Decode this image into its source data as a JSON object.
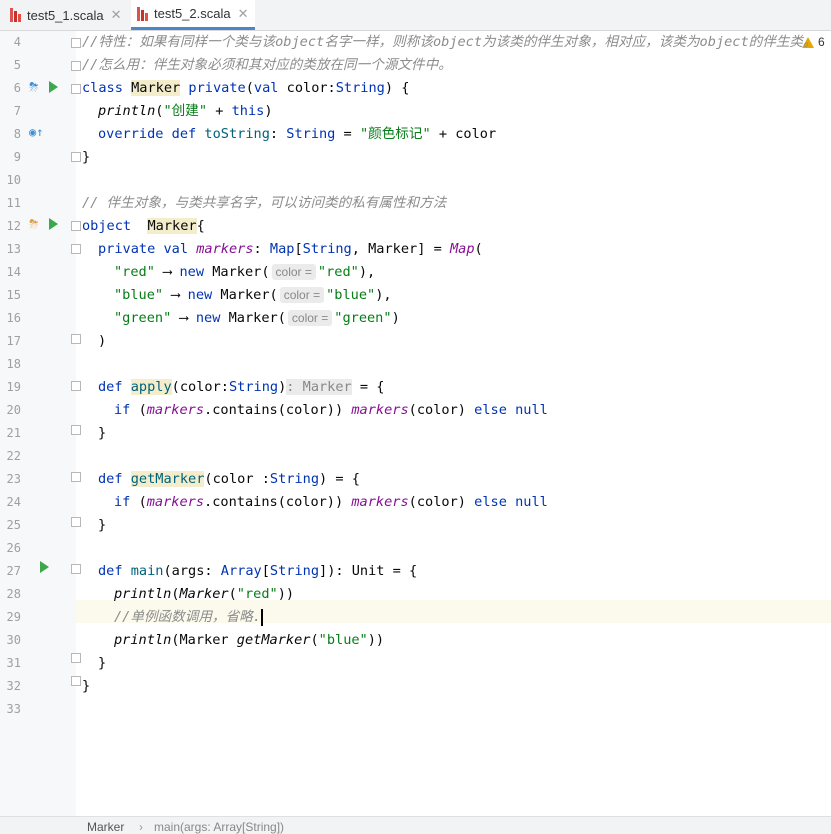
{
  "tabs": [
    {
      "label": "test5_1.scala",
      "active": false
    },
    {
      "label": "test5_2.scala",
      "active": true
    }
  ],
  "editor": {
    "warning_count": "6",
    "line_numbers": [
      "4",
      "5",
      "6",
      "7",
      "8",
      "9",
      "10",
      "11",
      "12",
      "13",
      "14",
      "15",
      "16",
      "17",
      "18",
      "19",
      "20",
      "21",
      "22",
      "23",
      "24",
      "25",
      "26",
      "27",
      "28",
      "29",
      "30",
      "31",
      "32",
      "33"
    ],
    "comment_l4": "//特性：如果有同样一个类与该object名字一样，则称该object为该类的伴生对象，相对应，该类为object的伴生类。",
    "comment_l5": "//怎么用：伴生对象必须和其对应的类放在同一个源文件中。",
    "comment_l11": "// 伴生对象，与类共享名字，可以访问类的私有属性和方法",
    "comment_l29": "//单例函数调用，省略.",
    "str_create": "\"创建\"",
    "str_colormark": "\"颜色标记\"",
    "str_red": "\"red\"",
    "str_blue": "\"blue\"",
    "str_green": "\"green\"",
    "hint_color": "color =",
    "hint_type": ": Marker"
  },
  "status_bar": {
    "breadcrumb_1": "Marker",
    "separator": "›",
    "breadcrumb_2": "main(args: Array[String])"
  }
}
